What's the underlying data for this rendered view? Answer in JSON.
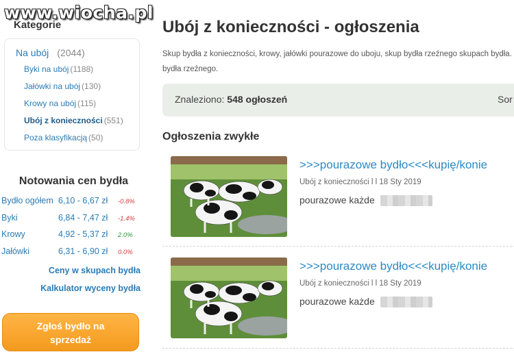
{
  "watermark": "www.wiocha.pl",
  "sidebar": {
    "categories_heading": "Kategorie",
    "main_category": {
      "label": "Na ubój",
      "count": "(2044)"
    },
    "items": [
      {
        "label": "Byki na ubój",
        "count": "(1188)"
      },
      {
        "label": "Jałówki na ubój",
        "count": "(130)"
      },
      {
        "label": "Krowy na ubój",
        "count": "(115)"
      },
      {
        "label": "Ubój z konieczności",
        "count": "(551)",
        "active": true
      },
      {
        "label": "Poza klasyfikacją",
        "count": "(50)"
      }
    ],
    "prices_title": "Notowania cen bydła",
    "prices": [
      {
        "name": "Bydło ogółem",
        "range": "6,10 - 6,67 zł",
        "change": "-0.8%"
      },
      {
        "name": "Byki",
        "range": "6,84 - 7,47 zł",
        "change": "-1.4%"
      },
      {
        "name": "Krowy",
        "range": "4,92 - 5,37 zł",
        "change": "2.0%"
      },
      {
        "name": "Jałówki",
        "range": "6,31 - 6,90 zł",
        "change": "0.0%"
      }
    ],
    "link_prices": "Ceny w skupach bydła",
    "link_calculator": "Kalkulator wyceny bydła",
    "cta_line1": "Zgłoś bydło na",
    "cta_line2": "sprzedaż"
  },
  "main": {
    "title": "Ubój z konieczności - ogłoszenia",
    "description": "Skup bydła z konieczności, krowy, jałówki pourazowe do uboju, skup bydła rzeźnego skupach bydła. Ceny bydła rzeźnego.",
    "found_label": "Znaleziono:",
    "found_count": "548 ogłoszeń",
    "sort_label": "Sor",
    "section_title": "Ogłoszenia zwykłe",
    "listings": [
      {
        "title": ">>>pourazowe bydło<<<kupię/konie",
        "meta": "Ubój z konieczności l l 18 Sty 2019",
        "desc": "pourazowe każde"
      },
      {
        "title": ">>>pourazowe bydło<<<kupię/konie",
        "meta": "Ubój z konieczności l l 18 Sty 2019",
        "desc": "pourazowe każde"
      }
    ]
  },
  "colors": {
    "link": "#2a7bb5",
    "accent_orange": "#f39a1e",
    "negative": "#d23b3b",
    "positive": "#2a9a3a"
  }
}
